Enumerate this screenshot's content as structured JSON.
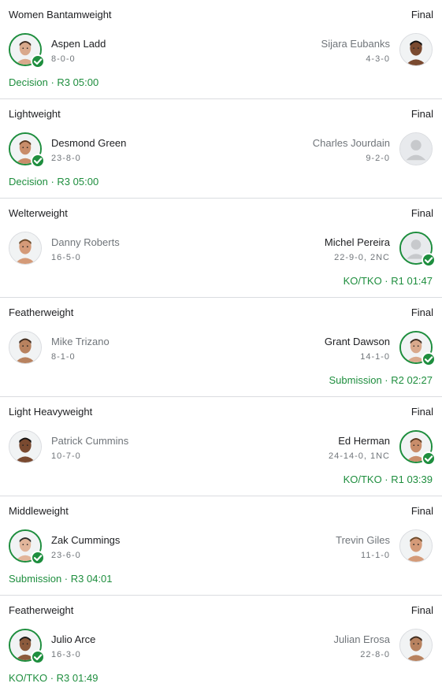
{
  "colors": {
    "win": "#1e8e3e",
    "text": "#202124",
    "muted": "#70757a",
    "divider": "#dadce0"
  },
  "fights": [
    {
      "division": "Women Bantamweight",
      "status": "Final",
      "left": {
        "name": "Aspen Ladd",
        "record": "8-0-0",
        "winner": true,
        "avatar": "fighter-photo"
      },
      "right": {
        "name": "Sijara Eubanks",
        "record": "4-3-0",
        "winner": false,
        "avatar": "fighter-photo"
      },
      "result": "Decision · R3 05:00",
      "result_side": "left"
    },
    {
      "division": "Lightweight",
      "status": "Final",
      "left": {
        "name": "Desmond Green",
        "record": "23-8-0",
        "winner": true,
        "avatar": "fighter-photo"
      },
      "right": {
        "name": "Charles Jourdain",
        "record": "9-2-0",
        "winner": false,
        "avatar": "placeholder-avatar"
      },
      "result": "Decision · R3 05:00",
      "result_side": "left"
    },
    {
      "division": "Welterweight",
      "status": "Final",
      "left": {
        "name": "Danny Roberts",
        "record": "16-5-0",
        "winner": false,
        "avatar": "fighter-photo"
      },
      "right": {
        "name": "Michel Pereira",
        "record": "22-9-0, 2NC",
        "winner": true,
        "avatar": "placeholder-avatar"
      },
      "result": "KO/TKO · R1 01:47",
      "result_side": "right"
    },
    {
      "division": "Featherweight",
      "status": "Final",
      "left": {
        "name": "Mike Trizano",
        "record": "8-1-0",
        "winner": false,
        "avatar": "fighter-photo"
      },
      "right": {
        "name": "Grant Dawson",
        "record": "14-1-0",
        "winner": true,
        "avatar": "fighter-photo"
      },
      "result": "Submission · R2 02:27",
      "result_side": "right"
    },
    {
      "division": "Light Heavyweight",
      "status": "Final",
      "left": {
        "name": "Patrick Cummins",
        "record": "10-7-0",
        "winner": false,
        "avatar": "fighter-photo"
      },
      "right": {
        "name": "Ed Herman",
        "record": "24-14-0, 1NC",
        "winner": true,
        "avatar": "fighter-photo"
      },
      "result": "KO/TKO · R1 03:39",
      "result_side": "right"
    },
    {
      "division": "Middleweight",
      "status": "Final",
      "left": {
        "name": "Zak Cummings",
        "record": "23-6-0",
        "winner": true,
        "avatar": "fighter-photo"
      },
      "right": {
        "name": "Trevin Giles",
        "record": "11-1-0",
        "winner": false,
        "avatar": "fighter-photo"
      },
      "result": "Submission · R3 04:01",
      "result_side": "left"
    },
    {
      "division": "Featherweight",
      "status": "Final",
      "left": {
        "name": "Julio Arce",
        "record": "16-3-0",
        "winner": true,
        "avatar": "fighter-photo"
      },
      "right": {
        "name": "Julian Erosa",
        "record": "22-8-0",
        "winner": false,
        "avatar": "fighter-photo"
      },
      "result": "KO/TKO · R3 01:49",
      "result_side": "left"
    }
  ]
}
